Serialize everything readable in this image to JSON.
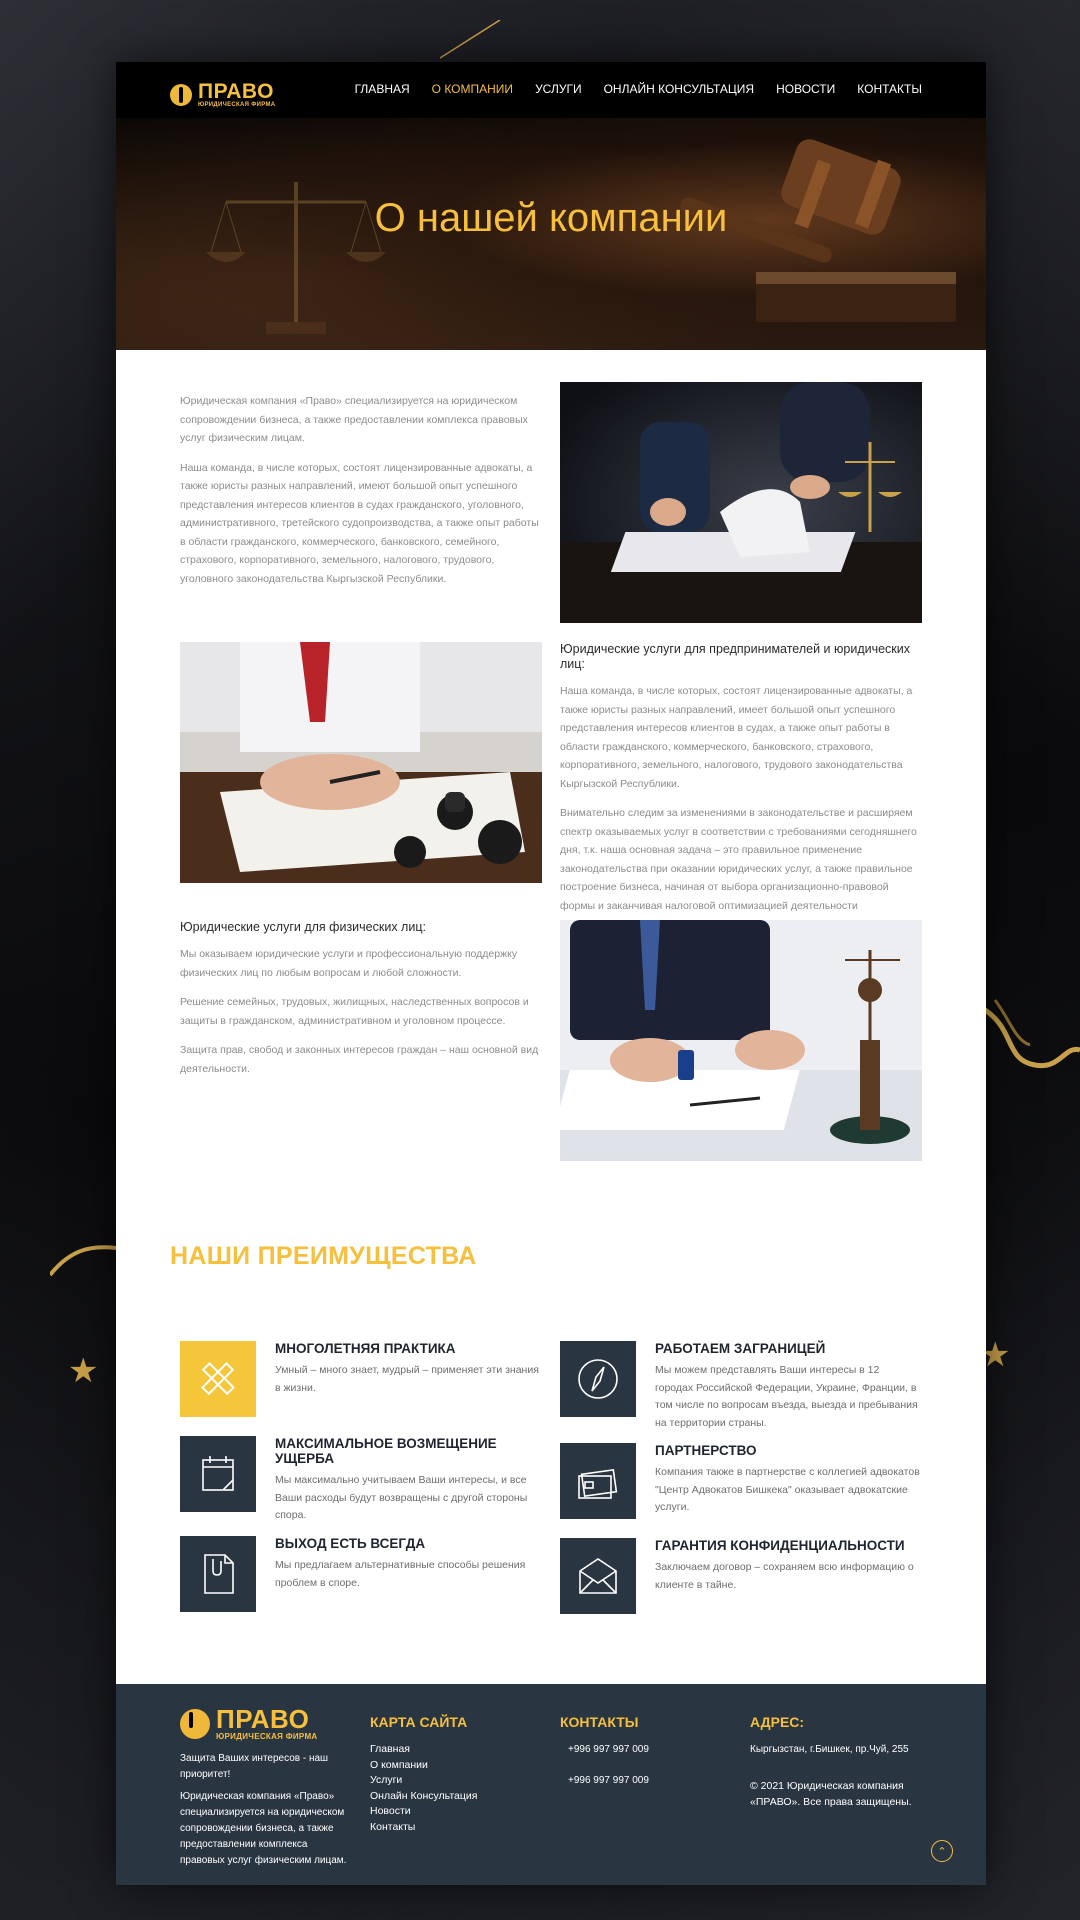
{
  "brand": {
    "name": "ПРАВО",
    "tagline": "ЮРИДИЧЕСКАЯ ФИРМА"
  },
  "nav": {
    "items": [
      {
        "label": "ГЛАВНАЯ",
        "active": false
      },
      {
        "label": "О КОМПАНИИ",
        "active": true
      },
      {
        "label": "УСЛУГИ",
        "active": false
      },
      {
        "label": "ОНЛАЙН КОНСУЛЬТАЦИЯ",
        "active": false
      },
      {
        "label": "НОВОСТИ",
        "active": false
      },
      {
        "label": "КОНТАКТЫ",
        "active": false
      }
    ]
  },
  "hero": {
    "title": "О нашей компании"
  },
  "about": {
    "p1": "Юридическая компания «Право» специализируется на юридическом сопровождении бизнеса, а также предоставлении комплекса правовых услуг физическим лицам.",
    "p2": "Наша команда, в числе которых, состоят лицензированные адвокаты, а также юристы разных направлений, имеют большой опыт успешного представления интересов клиентов в судах гражданского, уголовного, административного, третейского судопроизводства, а также опыт работы в области гражданского, коммерческого, банковского, семейного, страхового, корпоративного, земельного, налогового, трудового, уголовного законодательства Кыргызской Республики."
  },
  "business": {
    "heading": "Юридические услуги для предпринимателей и юридических лиц:",
    "p1": "Наша команда, в числе которых, состоят лицензированные адвокаты, а также юристы разных направлений, имеет большой опыт успешного представления интересов клиентов в судах, а также опыт работы в области гражданского, коммерческого, банковского, страхового, корпоративного, земельного, налогового, трудового законодательства Кыргызской Республики.",
    "p2": "Внимательно следим за изменениями в законодательстве и расширяем спектр оказываемых услуг в соответствии с требованиями сегодняшнего дня, т.к. наша основная задача – это правильное применение законодательства при оказании юридических услуг, а также правильное построение бизнеса, начиная от выбора организационно-правовой формы и заканчивая налоговой оптимизацией деятельности предприятия."
  },
  "individuals": {
    "heading": "Юридические услуги для физических лиц:",
    "p1": "Мы оказываем юридические услуги и профессиональную поддержку физических лиц по любым вопросам и любой сложности.",
    "p2": "Решение семейных, трудовых, жилищных, наследственных вопросов и защиты в гражданском, административном и уголовном процессе.",
    "p3": "Защита прав, свобод и законных интересов граждан – наш основной вид деятельности."
  },
  "advantages": {
    "title": "НАШИ ПРЕИМУЩЕСТВА",
    "items": [
      {
        "icon": "tools-icon",
        "title": "МНОГОЛЕТНЯЯ ПРАКТИКА",
        "text": "Умный – много знает, мудрый – применяет эти знания в жизни."
      },
      {
        "icon": "calendar-icon",
        "title": "МАКСИМАЛЬНОЕ ВОЗМЕЩЕНИЕ УЩЕРБА",
        "text": "Мы максимально учитываем Ваши интересы, и все Ваши расходы будут возвращены с другой стороны спора."
      },
      {
        "icon": "document-icon",
        "title": "ВЫХОД ЕСТЬ ВСЕГДА",
        "text": "Мы предлагаем альтернативные способы решения проблем в споре."
      },
      {
        "icon": "compass-icon",
        "title": "РАБОТАЕМ ЗАГРАНИЦЕЙ",
        "text": "Мы можем представлять Ваши интересы в 12 городах Российской Федерации, Украине, Франции, в том числе по вопросам въезда, выезда и пребывания на территории страны."
      },
      {
        "icon": "cards-icon",
        "title": "ПАРТНЕРСТВО",
        "text": "Компания также в партнерстве с коллегией адвокатов \"Центр Адвокатов Бишкека\" оказывает адвокатские услуги."
      },
      {
        "icon": "envelope-icon",
        "title": "ГАРАНТИЯ КОНФИДЕНЦИАЛЬНОСТИ",
        "text": "Заключаем договор – сохраняем всю информацию о клиенте в тайне."
      }
    ]
  },
  "footer": {
    "motto": "Защита Ваших интересов - наш приоритет!",
    "about": "Юридическая компания «Право» специализируется на юридическом сопровождении бизнеса, а также предоставлении комплекса правовых услуг физическим лицам.",
    "sitemap_title": "КАРТА САЙТА",
    "sitemap": [
      "Главная",
      "О компании",
      "Услуги",
      "Онлайн Консультация",
      "Новости",
      "Контакты"
    ],
    "contacts_title": "КОНТАКТЫ",
    "phones": [
      "+996 997 997 009",
      "+996 997 997 009"
    ],
    "address_title": "АДРЕС:",
    "address": "Кыргызстан, г.Бишкек, пр.Чуй, 255",
    "copyright": "© 2021 Юридическая компания «ПРАВО». Все права защищены.",
    "up_icon": "chevron-up-icon"
  },
  "colors": {
    "accent": "#f6bf3c",
    "dark_panel": "#2a3542",
    "page_bg": "#0b0c0f"
  }
}
